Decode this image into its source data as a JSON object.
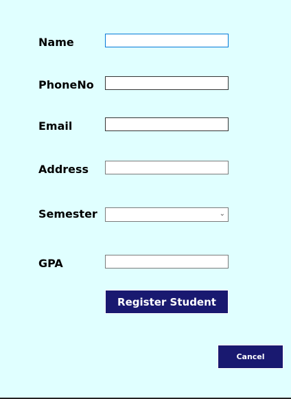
{
  "form": {
    "fields": [
      {
        "label": "Name",
        "value": ""
      },
      {
        "label": "PhoneNo",
        "value": ""
      },
      {
        "label": "Email",
        "value": ""
      },
      {
        "label": "Address",
        "value": ""
      },
      {
        "label": "Semester",
        "value": ""
      },
      {
        "label": "GPA",
        "value": ""
      }
    ],
    "register_label": "Register Student",
    "cancel_label": "Cancel"
  },
  "colors": {
    "background": "#E0FFFF",
    "button": "#191970"
  }
}
